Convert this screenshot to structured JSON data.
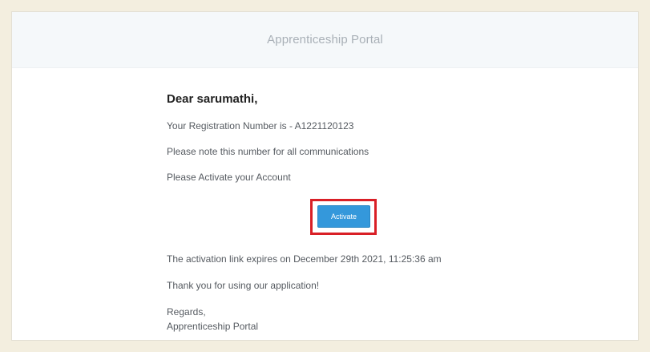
{
  "header": {
    "title": "Apprenticeship Portal"
  },
  "email": {
    "greeting": "Dear sarumathi,",
    "registration_line": "Your Registration Number is - A1221120123",
    "note_line": "Please note this number for all communications",
    "activate_prompt": "Please Activate your Account",
    "activate_button_label": "Activate",
    "expiry_line": "The activation link expires on December 29th 2021, 11:25:36 am",
    "thanks_line": "Thank you for using our application!",
    "regards": "Regards,",
    "signature": "Apprenticeship Portal"
  },
  "colors": {
    "page_background": "#f3eedf",
    "header_background": "#f5f8fa",
    "button": "#3498db",
    "highlight_box": "#d91f26"
  }
}
